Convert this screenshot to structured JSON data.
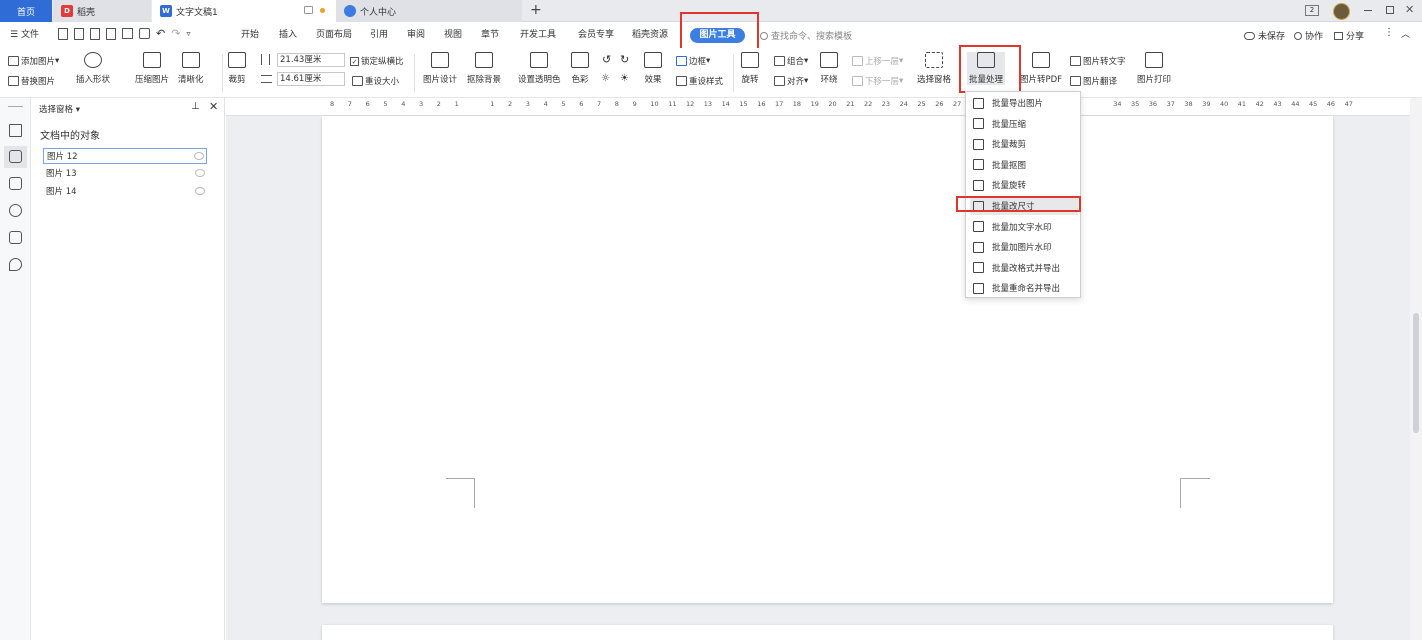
{
  "tabs": {
    "home": "首页",
    "daoke": "稻壳",
    "doc": "文字文稿1",
    "center": "个人中心",
    "new": "+",
    "badge": "2"
  },
  "menu": {
    "file": "文件",
    "items": [
      "开始",
      "插入",
      "页面布局",
      "引用",
      "审阅",
      "视图",
      "章节",
      "开发工具",
      "会员专享",
      "稻壳资源"
    ],
    "active": "图片工具",
    "search": "查找命令、搜索模板",
    "unsaved": "未保存",
    "collab": "协作",
    "share": "分享"
  },
  "ribbon": {
    "add_image": "添加图片",
    "replace_image": "替换图片",
    "insert_shape": "插入形状",
    "compress": "压缩图片",
    "clarity": "清晰化",
    "crop": "裁剪",
    "width": "21.43厘米",
    "height": "14.61厘米",
    "lock_ratio": "锁定纵横比",
    "reset_size": "重设大小",
    "design": "图片设计",
    "remove_bg": "抠除背景",
    "transparent": "设置透明色",
    "color": "色彩",
    "effect": "效果",
    "border": "边框",
    "reset_style": "重设样式",
    "rotate": "旋转",
    "group": "组合",
    "align": "对齐",
    "wrap": "环绕",
    "bring_forward": "上移一层",
    "send_backward": "下移一层",
    "select_pane": "选择窗格",
    "batch": "批量处理",
    "to_pdf": "图片转PDF",
    "to_text": "图片转文字",
    "translate": "图片翻译",
    "print": "图片打印"
  },
  "pane": {
    "title": "选择窗格",
    "subtitle": "文档中的对象",
    "objects": [
      "图片 12",
      "图片 13",
      "图片 14"
    ]
  },
  "ruler": [
    "8",
    "7",
    "6",
    "5",
    "4",
    "3",
    "2",
    "1",
    "",
    "1",
    "2",
    "3",
    "4",
    "5",
    "6",
    "7",
    "8",
    "9",
    "10",
    "11",
    "12",
    "13",
    "14",
    "15",
    "16",
    "17",
    "18",
    "19",
    "20",
    "21",
    "22",
    "23",
    "24",
    "25",
    "26",
    "27",
    "",
    "",
    "",
    "",
    "",
    "",
    "",
    "",
    "34",
    "35",
    "36",
    "37",
    "38",
    "39",
    "40",
    "41",
    "42",
    "43",
    "44",
    "45",
    "46",
    "47"
  ],
  "dropdown": [
    "批量导出图片",
    "批量压缩",
    "批量裁剪",
    "批量抠图",
    "批量旋转",
    "批量改尺寸",
    "批量加文字水印",
    "批量加图片水印",
    "批量改格式并导出",
    "批量重命名并导出"
  ],
  "colors": {
    "accent": "#2f6cd6",
    "highlight": "#e0362b",
    "active_tab": "#3d7fe0"
  }
}
